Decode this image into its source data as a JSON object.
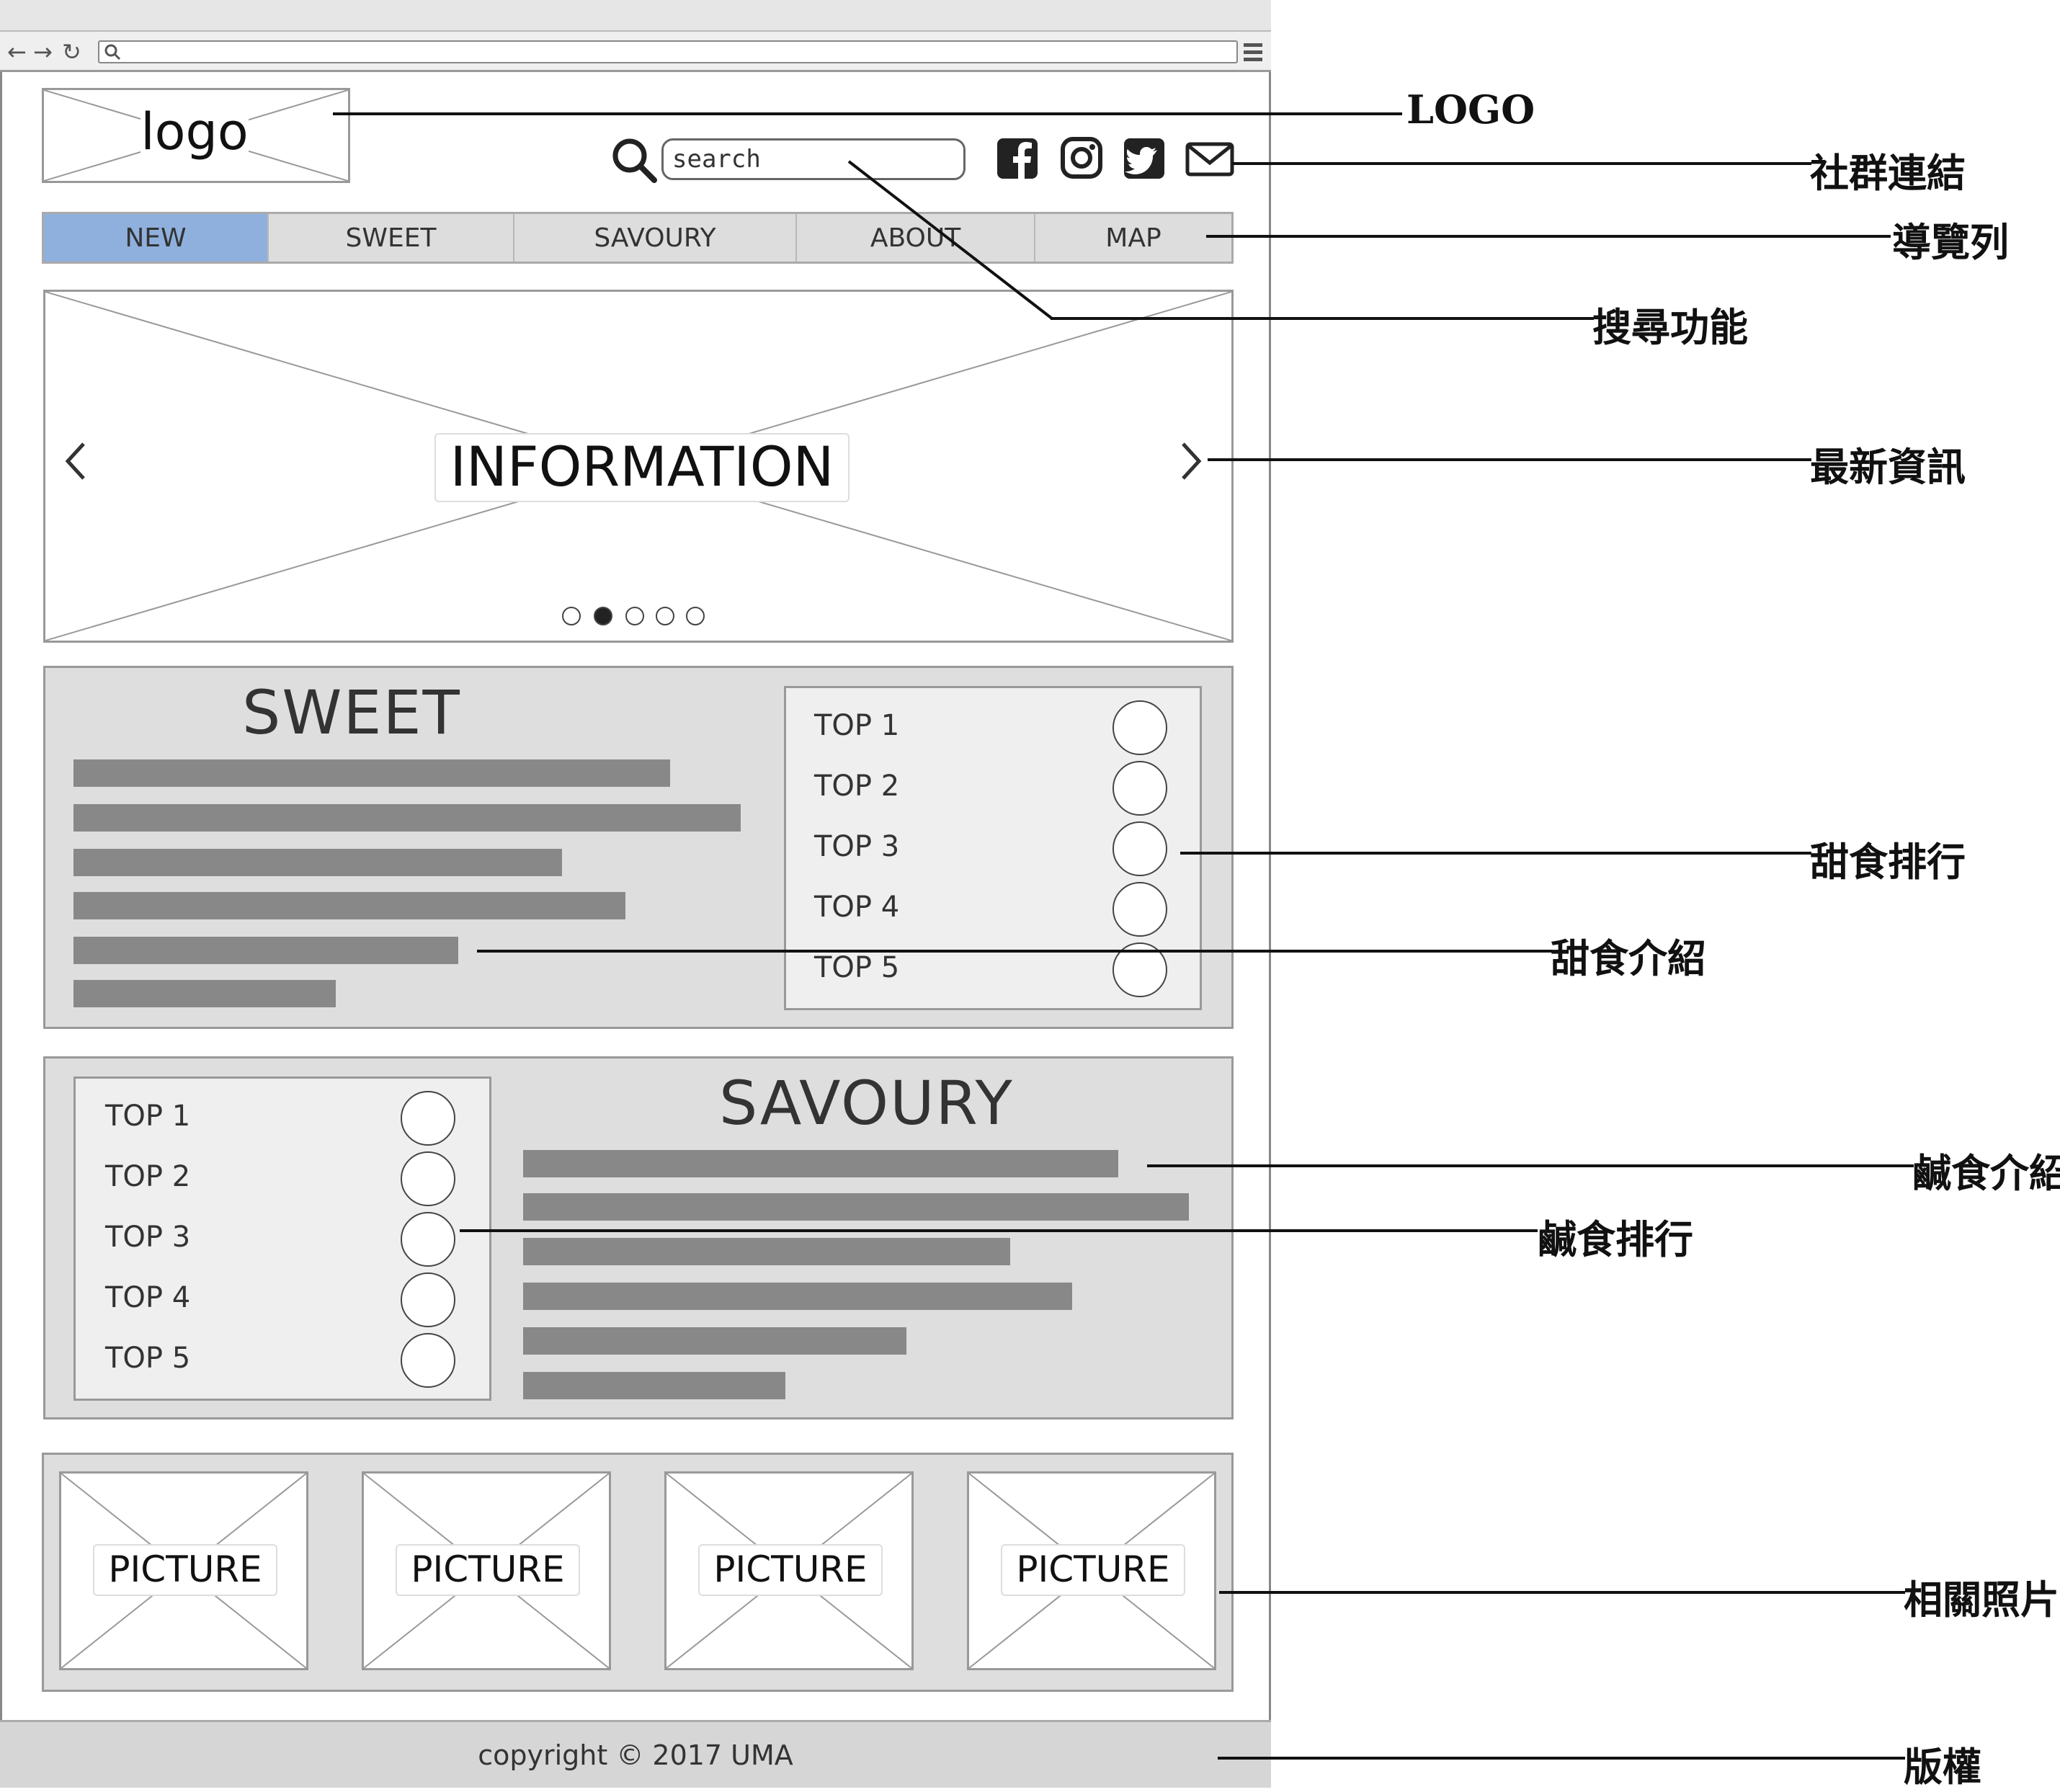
{
  "header": {
    "logo_text": "logo",
    "search_placeholder": "search"
  },
  "nav": {
    "tabs": [
      "NEW",
      "SWEET",
      "SAVOURY",
      "ABOUT",
      "MAP"
    ],
    "active": "NEW"
  },
  "carousel": {
    "label": "INFORMATION",
    "prev_icon": "chevron-left-icon",
    "next_icon": "chevron-right-icon",
    "dots": 5,
    "active_dot": 2
  },
  "sweet": {
    "title": "SWEET",
    "ranks": [
      "TOP 1",
      "TOP 2",
      "TOP 3",
      "TOP 4",
      "TOP 5"
    ]
  },
  "savoury": {
    "title": "SAVOURY",
    "ranks": [
      "TOP 1",
      "TOP 2",
      "TOP 3",
      "TOP 4",
      "TOP 5"
    ]
  },
  "pictures": {
    "labels": [
      "PICTURE",
      "PICTURE",
      "PICTURE",
      "PICTURE"
    ]
  },
  "footer": {
    "copyright": "copyright © 2017 UMA"
  },
  "social_icons": [
    "facebook-icon",
    "instagram-icon",
    "twitter-icon",
    "mail-icon"
  ],
  "annotations": {
    "logo": "LOGO",
    "social": "社群連結",
    "nav": "導覽列",
    "search": "搜尋功能",
    "info": "最新資訊",
    "sweet_rank": "甜食排行",
    "sweet_intro": "甜食介紹",
    "savoury_intro": "鹹食介紹",
    "savoury_rank": "鹹食排行",
    "pictures": "相關照片",
    "copyright": "版權"
  },
  "colors": {
    "active_tab": "#8fb0dd",
    "section_bg": "#dedede",
    "text_bar": "#888888"
  }
}
